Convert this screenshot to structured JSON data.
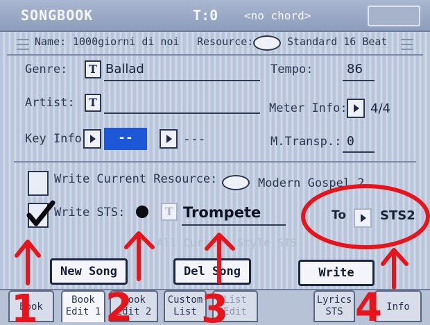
{
  "title_bar": {
    "app_name": "SONGBOOK",
    "tempo_label": "T:0",
    "chord_label": "<no chord>"
  },
  "entry_bar": {
    "name_label": "Name:",
    "name_value": "1000giorni di noi",
    "resource_label": "Resource:",
    "resource_value": "Standard 16 Beat"
  },
  "fields": {
    "genre_label": "Genre:",
    "genre_value": "Ballad",
    "tempo_label": "Tempo:",
    "tempo_value": "86",
    "artist_label": "Artist:",
    "artist_value": "",
    "meter_label": "Meter Info:",
    "meter_value": "4/4",
    "key_label": "Key Info:",
    "key_value": "--",
    "key_mode_value": "---",
    "mtransp_label": "M.Transp.:",
    "mtransp_value": "0",
    "t_icon": "T"
  },
  "write_options": {
    "write_resource_label": "Write Current Resource:",
    "write_resource_value": "Modern Gospel 2",
    "write_resource_checked": false,
    "write_sts_label": "Write STS:",
    "write_sts_checked": true,
    "sts_name": "Trompete",
    "all_sts_label": "All Current Style STS",
    "to_label": "To",
    "sts_target": "STS2"
  },
  "buttons": {
    "new_song": "New Song",
    "del_song": "Del Song",
    "write": "Write"
  },
  "tabs": [
    {
      "label": "Book",
      "active": false,
      "enabled": true
    },
    {
      "label": "Book\nEdit 1",
      "active": true,
      "enabled": true
    },
    {
      "label": "Book\nEdit 2",
      "active": false,
      "enabled": true
    },
    {
      "label": "Custom\nList",
      "active": false,
      "enabled": true
    },
    {
      "label": "List\nEdit",
      "active": false,
      "enabled": false
    },
    {
      "label": "Lyrics\nSTS",
      "active": false,
      "enabled": true
    },
    {
      "label": "Info",
      "active": false,
      "enabled": true
    }
  ],
  "annotations": {
    "numbers": [
      "1",
      "2",
      "3",
      "4"
    ],
    "color": "#e8141c"
  },
  "colors": {
    "selection": "#1b57d6",
    "annotation": "#e8141c"
  }
}
